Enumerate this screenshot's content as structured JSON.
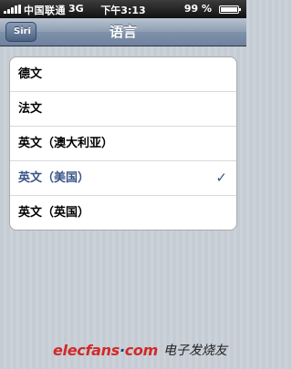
{
  "status_bar": {
    "carrier": "中国联通",
    "network": "3G",
    "time": "下午3:13",
    "battery": "99 %",
    "battery_level": 0.99
  },
  "nav": {
    "back_label": "Siri",
    "title": "语言"
  },
  "languages": [
    {
      "label": "德文",
      "selected": false
    },
    {
      "label": "法文",
      "selected": false
    },
    {
      "label": "英文（澳大利亚）",
      "selected": false
    },
    {
      "label": "英文（美国）",
      "selected": true
    },
    {
      "label": "英文（英国）",
      "selected": false
    }
  ],
  "checkmark": "✓",
  "watermark": {
    "logo_main": "elecfans",
    "logo_dot": "·",
    "logo_com": "com",
    "chinese": "电子发烧友"
  },
  "colors": {
    "selected_text": "#385487",
    "nav_bar": "#7f91a9",
    "watermark_red": "#d12a2a"
  }
}
